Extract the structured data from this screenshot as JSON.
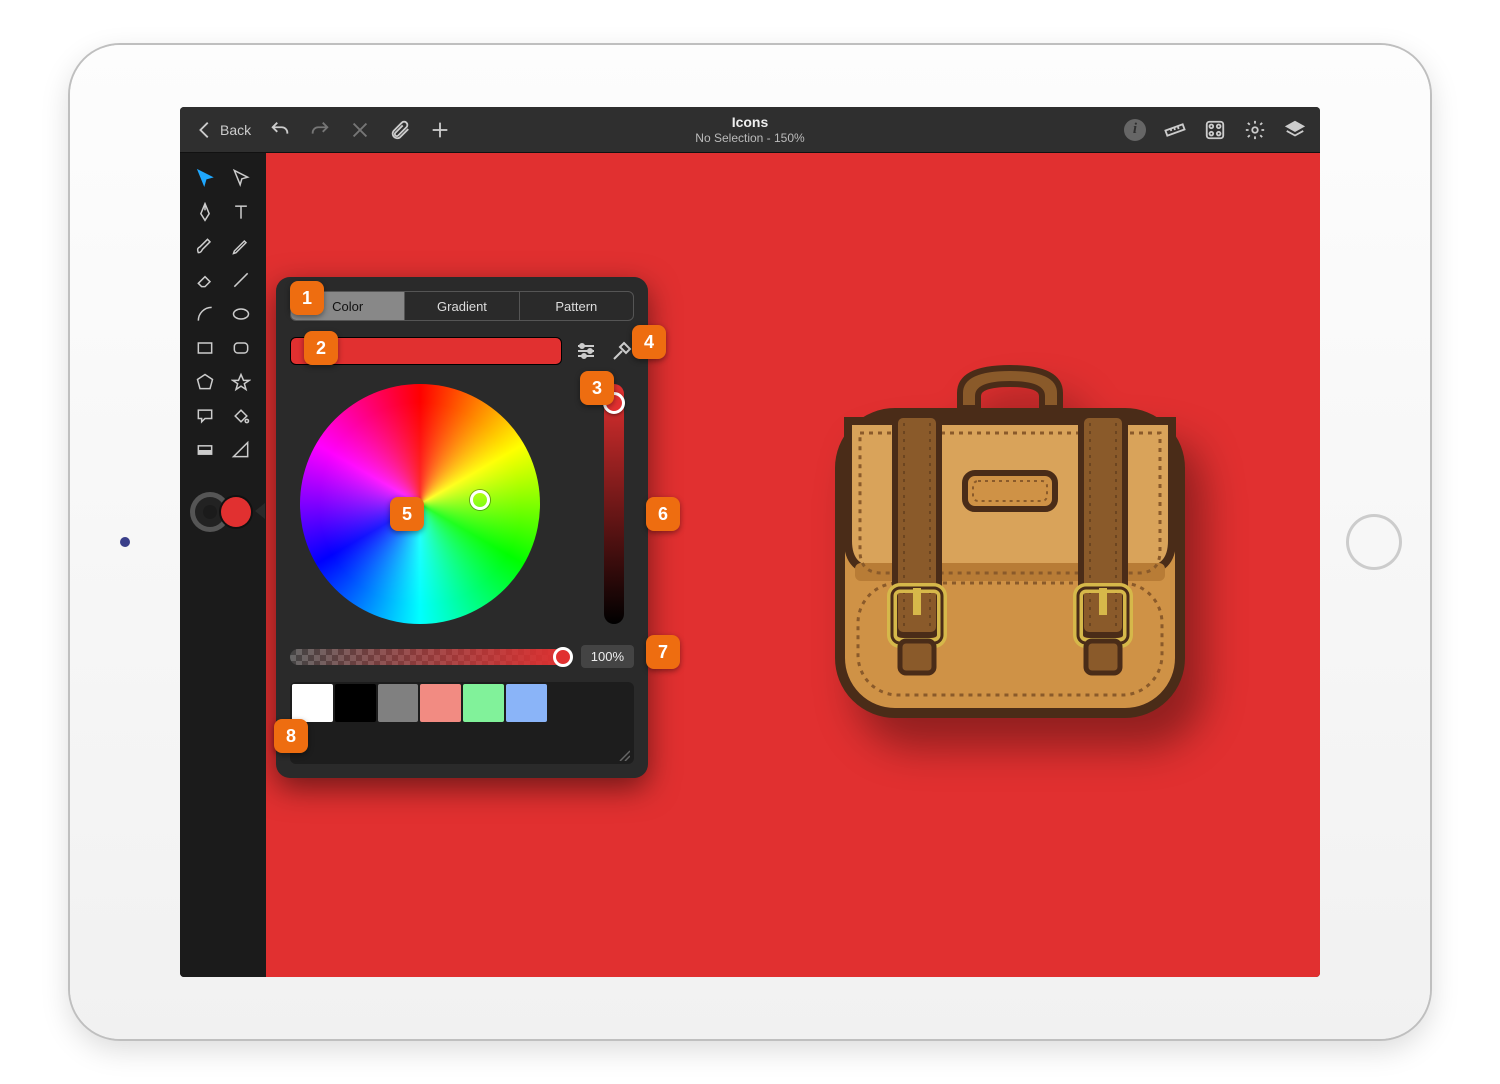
{
  "header": {
    "back_label": "Back",
    "title": "Icons",
    "subtitle": "No Selection - 150%"
  },
  "seg": {
    "color": "Color",
    "gradient": "Gradient",
    "pattern": "Pattern"
  },
  "opacity": {
    "value": "100%"
  },
  "current_color": "#e13030",
  "swatches": [
    "#ffffff",
    "#000000",
    "#808080",
    "#f28b82",
    "#81f29a",
    "#8ab4f8"
  ],
  "callouts": {
    "c1": "1",
    "c2": "2",
    "c3": "3",
    "c4": "4",
    "c5": "5",
    "c6": "6",
    "c7": "7",
    "c8": "8"
  },
  "tools": [
    "select",
    "direct-select",
    "pen",
    "text",
    "brush",
    "pencil",
    "eraser",
    "line",
    "arc",
    "ellipse",
    "rect",
    "round-rect",
    "polygon",
    "star",
    "speech",
    "pour",
    "swatch",
    "grad-tool"
  ]
}
